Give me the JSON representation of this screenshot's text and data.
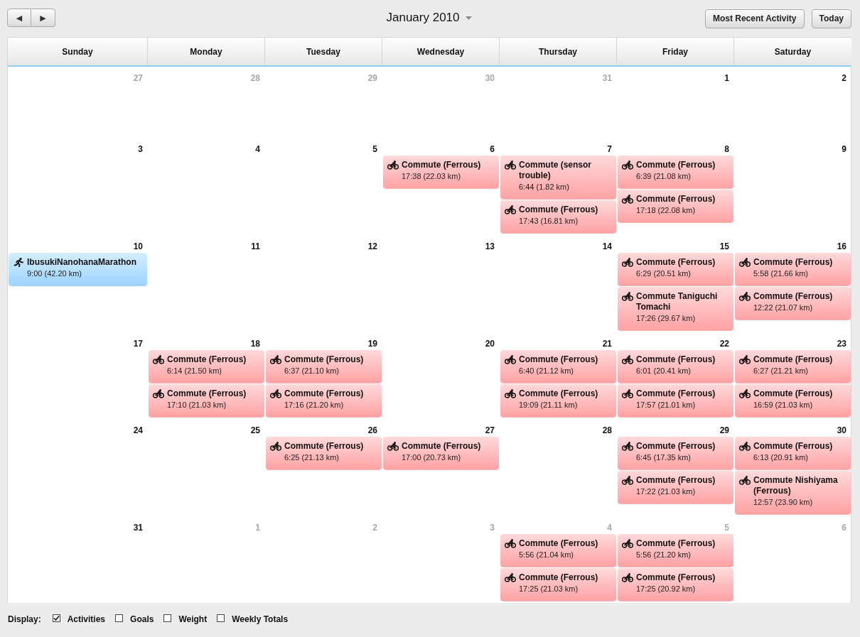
{
  "toolbar": {
    "nav_buttons": [
      "◀",
      "▶"
    ],
    "month_picker": {
      "label": "January 2010"
    },
    "buttons": [
      "Most Recent Activity",
      "Today"
    ]
  },
  "calendar": {
    "weekdays": [
      "Sunday",
      "Monday",
      "Tuesday",
      "Wednesday",
      "Thursday",
      "Friday",
      "Saturday"
    ],
    "weeks": [
      {
        "days": [
          {
            "date": "27",
            "other_month": true
          },
          {
            "date": "28",
            "other_month": true
          },
          {
            "date": "29",
            "other_month": true
          },
          {
            "date": "30",
            "other_month": true
          },
          {
            "date": "31",
            "other_month": true
          },
          {
            "date": "1",
            "other_month": false
          },
          {
            "date": "2",
            "other_month": false
          }
        ]
      },
      {
        "days": [
          {
            "date": "3",
            "other_month": false
          },
          {
            "date": "4",
            "other_month": false
          },
          {
            "date": "5",
            "other_month": false
          },
          {
            "date": "6",
            "other_month": false,
            "events": [
              {
                "kind": "bike",
                "title": "Commute (Ferrous)",
                "detail": "17:38 (22.03 km)"
              }
            ]
          },
          {
            "date": "7",
            "other_month": false,
            "events": [
              {
                "kind": "bike",
                "title": "Commute (sensor trouble)",
                "detail": "6:44 (1.82 km)"
              },
              {
                "kind": "bike",
                "title": "Commute (Ferrous)",
                "detail": "17:43 (16.81 km)"
              }
            ]
          },
          {
            "date": "8",
            "other_month": false,
            "events": [
              {
                "kind": "bike",
                "title": "Commute (Ferrous)",
                "detail": "6:39 (21.08 km)"
              },
              {
                "kind": "bike",
                "title": "Commute (Ferrous)",
                "detail": "17:18 (22.08 km)"
              }
            ]
          },
          {
            "date": "9",
            "other_month": false
          }
        ]
      },
      {
        "days": [
          {
            "date": "10",
            "other_month": false,
            "events": [
              {
                "kind": "run",
                "title": "IbusukiNanohanaMarathon",
                "detail": "9:00 (42.20 km)"
              }
            ]
          },
          {
            "date": "11",
            "other_month": false
          },
          {
            "date": "12",
            "other_month": false
          },
          {
            "date": "13",
            "other_month": false
          },
          {
            "date": "14",
            "other_month": false
          },
          {
            "date": "15",
            "other_month": false,
            "events": [
              {
                "kind": "bike",
                "title": "Commute (Ferrous)",
                "detail": "6:29 (20.51 km)"
              },
              {
                "kind": "bike",
                "title": "Commute Taniguchi Tomachi",
                "detail": "17:26 (29.67 km)"
              }
            ]
          },
          {
            "date": "16",
            "other_month": false,
            "events": [
              {
                "kind": "bike",
                "title": "Commute (Ferrous)",
                "detail": "5:58 (21.66 km)"
              },
              {
                "kind": "bike",
                "title": "Commute (Ferrous)",
                "detail": "12:22 (21.07 km)"
              }
            ]
          }
        ]
      },
      {
        "days": [
          {
            "date": "17",
            "other_month": false
          },
          {
            "date": "18",
            "other_month": false,
            "events": [
              {
                "kind": "bike",
                "title": "Commute (Ferrous)",
                "detail": "6:14 (21.50 km)"
              },
              {
                "kind": "bike",
                "title": "Commute (Ferrous)",
                "detail": "17:10 (21.03 km)"
              }
            ]
          },
          {
            "date": "19",
            "other_month": false,
            "events": [
              {
                "kind": "bike",
                "title": "Commute (Ferrous)",
                "detail": "6:37 (21.10 km)"
              },
              {
                "kind": "bike",
                "title": "Commute (Ferrous)",
                "detail": "17:16 (21.20 km)"
              }
            ]
          },
          {
            "date": "20",
            "other_month": false
          },
          {
            "date": "21",
            "other_month": false,
            "events": [
              {
                "kind": "bike",
                "title": "Commute (Ferrous)",
                "detail": "6:40 (21.12 km)"
              },
              {
                "kind": "bike",
                "title": "Commute (Ferrous)",
                "detail": "19:09 (21.11 km)"
              }
            ]
          },
          {
            "date": "22",
            "other_month": false,
            "events": [
              {
                "kind": "bike",
                "title": "Commute (Ferrous)",
                "detail": "6:01 (20.41 km)"
              },
              {
                "kind": "bike",
                "title": "Commute (Ferrous)",
                "detail": "17:57 (21.01 km)"
              }
            ]
          },
          {
            "date": "23",
            "other_month": false,
            "events": [
              {
                "kind": "bike",
                "title": "Commute (Ferrous)",
                "detail": "6:27 (21.21 km)"
              },
              {
                "kind": "bike",
                "title": "Commute (Ferrous)",
                "detail": "16:59 (21.03 km)"
              }
            ]
          }
        ]
      },
      {
        "days": [
          {
            "date": "24",
            "other_month": false
          },
          {
            "date": "25",
            "other_month": false
          },
          {
            "date": "26",
            "other_month": false,
            "events": [
              {
                "kind": "bike",
                "title": "Commute (Ferrous)",
                "detail": "6:25 (21.13 km)"
              }
            ]
          },
          {
            "date": "27",
            "other_month": false,
            "events": [
              {
                "kind": "bike",
                "title": "Commute (Ferrous)",
                "detail": "17:00 (20.73 km)"
              }
            ]
          },
          {
            "date": "28",
            "other_month": false
          },
          {
            "date": "29",
            "other_month": false,
            "events": [
              {
                "kind": "bike",
                "title": "Commute (Ferrous)",
                "detail": "6:45 (17.35 km)"
              },
              {
                "kind": "bike",
                "title": "Commute (Ferrous)",
                "detail": "17:22 (21.03 km)"
              }
            ]
          },
          {
            "date": "30",
            "other_month": false,
            "events": [
              {
                "kind": "bike",
                "title": "Commute (Ferrous)",
                "detail": "6:13 (20.91 km)"
              },
              {
                "kind": "bike",
                "title": "Commute Nishiyama (Ferrous)",
                "detail": "12:57 (23.90 km)"
              }
            ]
          }
        ]
      },
      {
        "days": [
          {
            "date": "31",
            "other_month": false
          },
          {
            "date": "1",
            "other_month": true
          },
          {
            "date": "2",
            "other_month": true
          },
          {
            "date": "3",
            "other_month": true
          },
          {
            "date": "4",
            "other_month": true,
            "events": [
              {
                "kind": "bike",
                "title": "Commute (Ferrous)",
                "detail": "5:56 (21.04 km)"
              },
              {
                "kind": "bike",
                "title": "Commute (Ferrous)",
                "detail": "17:25 (21.03 km)"
              }
            ]
          },
          {
            "date": "5",
            "other_month": true,
            "events": [
              {
                "kind": "bike",
                "title": "Commute (Ferrous)",
                "detail": "5:56 (21.20 km)"
              },
              {
                "kind": "bike",
                "title": "Commute (Ferrous)",
                "detail": "17:25 (20.92 km)"
              }
            ]
          },
          {
            "date": "6",
            "other_month": true
          }
        ]
      }
    ]
  },
  "display_bar": {
    "label": "Display:",
    "options": [
      {
        "label": "Activities",
        "checked": true
      },
      {
        "label": "Goals",
        "checked": false
      },
      {
        "label": "Weight",
        "checked": false
      },
      {
        "label": "Weekly Totals",
        "checked": false
      }
    ]
  }
}
